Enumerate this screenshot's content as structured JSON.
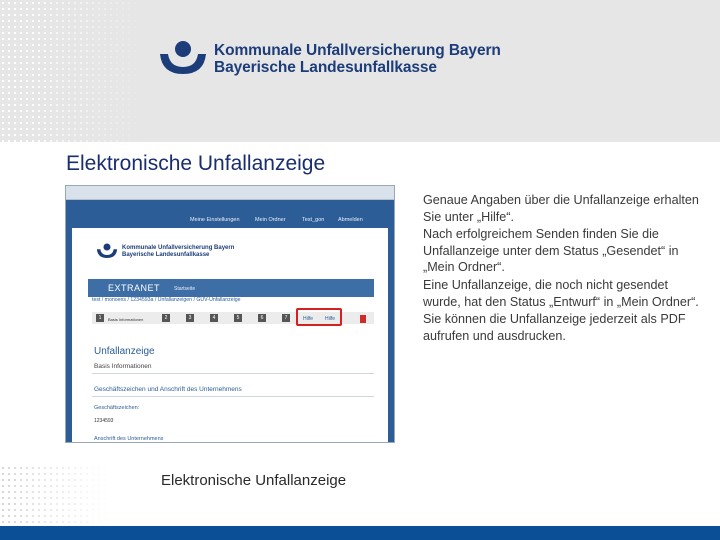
{
  "header": {
    "org_name_line1": "Kommunale Unfallversicherung Bayern",
    "org_name_line2": "Bayerische Landesunfallkasse",
    "logo_icon": "kuvb-logo-icon"
  },
  "slide": {
    "title": "Elektronische Unfallanzeige",
    "caption": "Elektronische Unfallanzeige",
    "paragraphs": [
      "Genaue Angaben über die Unfallanzeige erhalten Sie unter „Hilfe“.",
      "Nach erfolgreichem Senden finden Sie die Unfallanzeige unter dem Status „Gesendet“ in „Mein Ordner“.",
      "Eine Unfallanzeige, die noch nicht gesendet wurde, hat den Status „Entwurf“ in „Mein Ordner“.",
      "Sie können die Unfallanzeige jederzeit als PDF aufrufen und ausdrucken."
    ]
  },
  "screenshot": {
    "nav": [
      "Meine Einstellungen",
      "Mein Ordner",
      "Test_gon",
      "Abmelden"
    ],
    "logo_line1": "Kommunale Unfallversicherung Bayern",
    "logo_line2": "Bayerische Landesunfallkasse",
    "extranet": "EXTRANET",
    "startseite": "Startseite",
    "breadcrumb": "test  /  monoens  /  1234593a  /  Unfallanzeigen  /  GUV-Unfallanzeige",
    "step_label": "Basis Informationen",
    "steps": [
      "1",
      "2",
      "3",
      "4",
      "5",
      "6",
      "7"
    ],
    "hilfe_1": "Hilfe",
    "hilfe_2": "Hilfe",
    "heading": "Unfallanzeige",
    "subheading": "Basis Informationen",
    "section": "Geschäftszeichen und Anschrift des Unternehmens",
    "field_label": "Geschäftszeichen:",
    "field_value": "1234593",
    "more": "Anschrift des Unternehmens"
  },
  "colors": {
    "brand_blue": "#1d3d7a",
    "footer_blue": "#0b4f96",
    "highlight_red": "#d32020"
  }
}
